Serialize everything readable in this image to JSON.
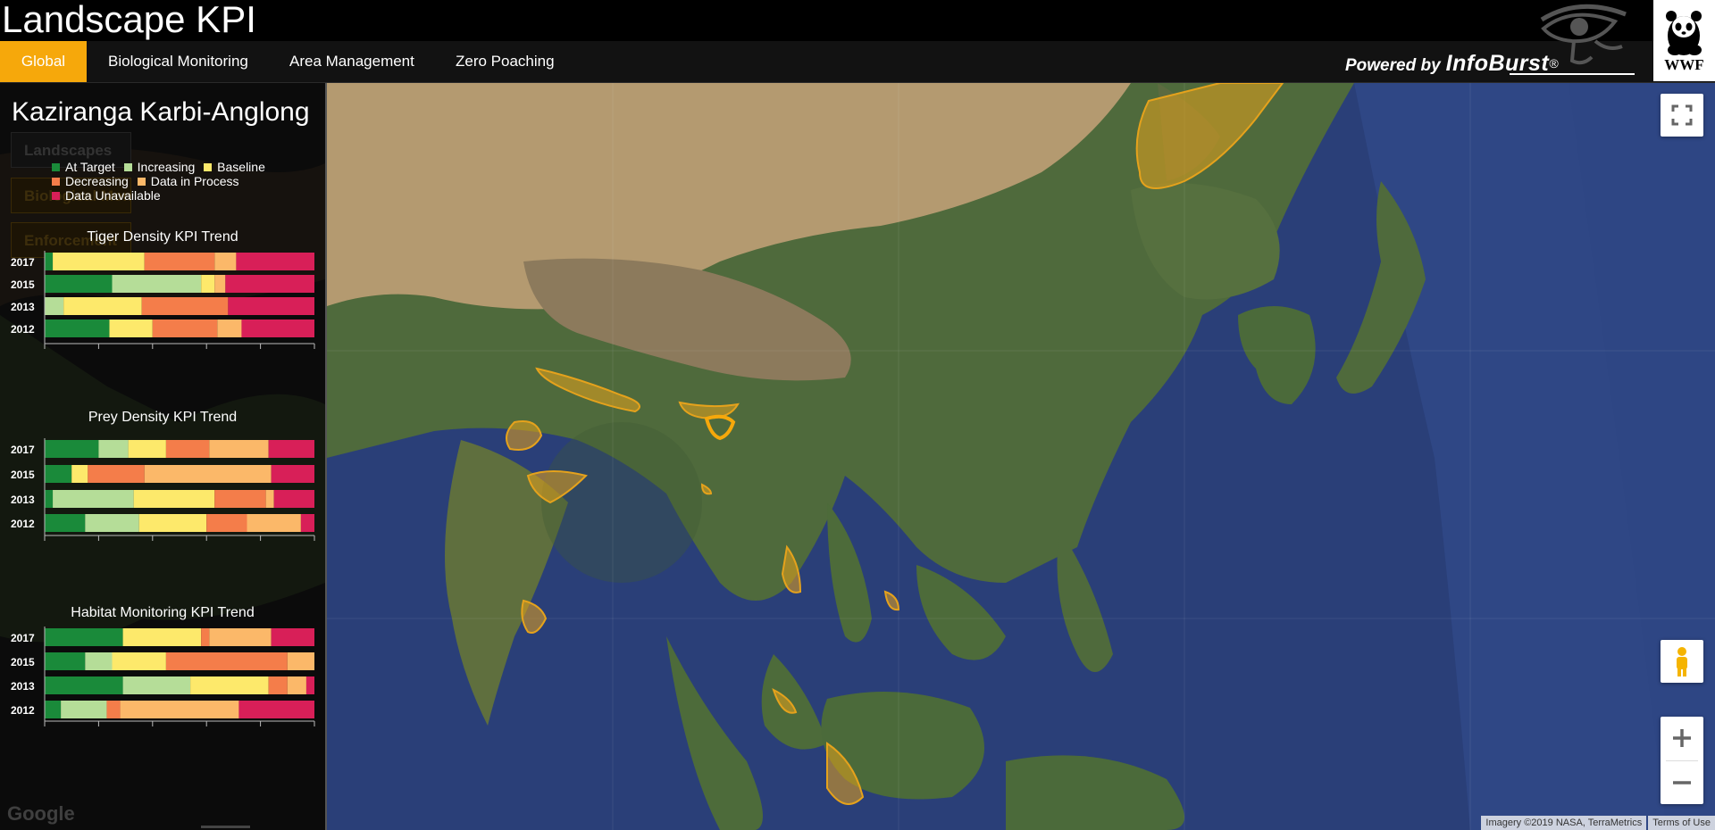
{
  "app": {
    "title": "Landscape KPI"
  },
  "nav": {
    "tabs": [
      {
        "label": "Global",
        "active": true
      },
      {
        "label": "Biological Monitoring",
        "active": false
      },
      {
        "label": "Area Management",
        "active": false
      },
      {
        "label": "Zero Poaching",
        "active": false
      }
    ]
  },
  "branding": {
    "powered_prefix": "Powered by",
    "powered_brand": "InfoBurst",
    "powered_reg": "®",
    "partner_logo_text": "WWF",
    "accent_color": "#f6a80b"
  },
  "sidebar": {
    "landscape_name": "Kaziranga Karbi-Anglong",
    "ghost_buttons": [
      "Landscapes",
      "Biological Monitoring",
      "Enforcement"
    ]
  },
  "legend": {
    "rows": [
      [
        {
          "label": "At Target",
          "color": "#1a8a3a"
        },
        {
          "label": "Increasing",
          "color": "#b5dd98"
        },
        {
          "label": "Baseline",
          "color": "#fde96b"
        }
      ],
      [
        {
          "label": "Decreasing",
          "color": "#f47d4a"
        },
        {
          "label": "Data in Process",
          "color": "#fbb869"
        }
      ],
      [
        {
          "label": "Data Unavailable",
          "color": "#d81f58"
        }
      ]
    ]
  },
  "chart_data": [
    {
      "type": "bar",
      "stacked": true,
      "orientation": "horizontal",
      "title": "Tiger Density KPI Trend",
      "categories": [
        "2017",
        "2015",
        "2013",
        "2012"
      ],
      "series": [
        {
          "name": "At Target",
          "color": "#1a8a3a",
          "values": [
            3,
            25,
            0,
            24
          ]
        },
        {
          "name": "Increasing",
          "color": "#b5dd98",
          "values": [
            0,
            33,
            7,
            0
          ]
        },
        {
          "name": "Baseline",
          "color": "#fde96b",
          "values": [
            34,
            5,
            29,
            16
          ]
        },
        {
          "name": "Decreasing",
          "color": "#f47d4a",
          "values": [
            26,
            0,
            32,
            24
          ]
        },
        {
          "name": "Data in Process",
          "color": "#fbb869",
          "values": [
            8,
            4,
            0,
            9
          ]
        },
        {
          "name": "Data Unavailable",
          "color": "#d81f58",
          "values": [
            29,
            33,
            32,
            27
          ]
        }
      ],
      "xlim": [
        0,
        100
      ]
    },
    {
      "type": "bar",
      "stacked": true,
      "orientation": "horizontal",
      "title": "Prey Density KPI Trend",
      "categories": [
        "2017",
        "2015",
        "2013",
        "2012"
      ],
      "series": [
        {
          "name": "At Target",
          "color": "#1a8a3a",
          "values": [
            20,
            10,
            3,
            15
          ]
        },
        {
          "name": "Increasing",
          "color": "#b5dd98",
          "values": [
            11,
            0,
            30,
            20
          ]
        },
        {
          "name": "Baseline",
          "color": "#fde96b",
          "values": [
            14,
            6,
            30,
            25
          ]
        },
        {
          "name": "Decreasing",
          "color": "#f47d4a",
          "values": [
            16,
            21,
            19,
            15
          ]
        },
        {
          "name": "Data in Process",
          "color": "#fbb869",
          "values": [
            22,
            47,
            3,
            20
          ]
        },
        {
          "name": "Data Unavailable",
          "color": "#d81f58",
          "values": [
            17,
            16,
            15,
            5
          ]
        }
      ],
      "xlim": [
        0,
        100
      ]
    },
    {
      "type": "bar",
      "stacked": true,
      "orientation": "horizontal",
      "title": "Habitat Monitoring KPI Trend",
      "categories": [
        "2017",
        "2015",
        "2013",
        "2012"
      ],
      "series": [
        {
          "name": "At Target",
          "color": "#1a8a3a",
          "values": [
            29,
            15,
            29,
            6
          ]
        },
        {
          "name": "Increasing",
          "color": "#b5dd98",
          "values": [
            0,
            10,
            25,
            17
          ]
        },
        {
          "name": "Baseline",
          "color": "#fde96b",
          "values": [
            29,
            20,
            29,
            0
          ]
        },
        {
          "name": "Decreasing",
          "color": "#f47d4a",
          "values": [
            3,
            45,
            7,
            5
          ]
        },
        {
          "name": "Data in Process",
          "color": "#fbb869",
          "values": [
            23,
            10,
            7,
            44
          ]
        },
        {
          "name": "Data Unavailable",
          "color": "#d81f58",
          "values": [
            16,
            0,
            3,
            28
          ]
        }
      ],
      "xlim": [
        0,
        100
      ]
    }
  ],
  "map": {
    "attribution_imagery": "Imagery ©2019 NASA, TerraMetrics",
    "attribution_terms": "Terms of Use",
    "google_mark": "Google",
    "ocean_color": "#2a3f78",
    "land_color": "#4f6a3c",
    "desert_color": "#b49a70"
  }
}
